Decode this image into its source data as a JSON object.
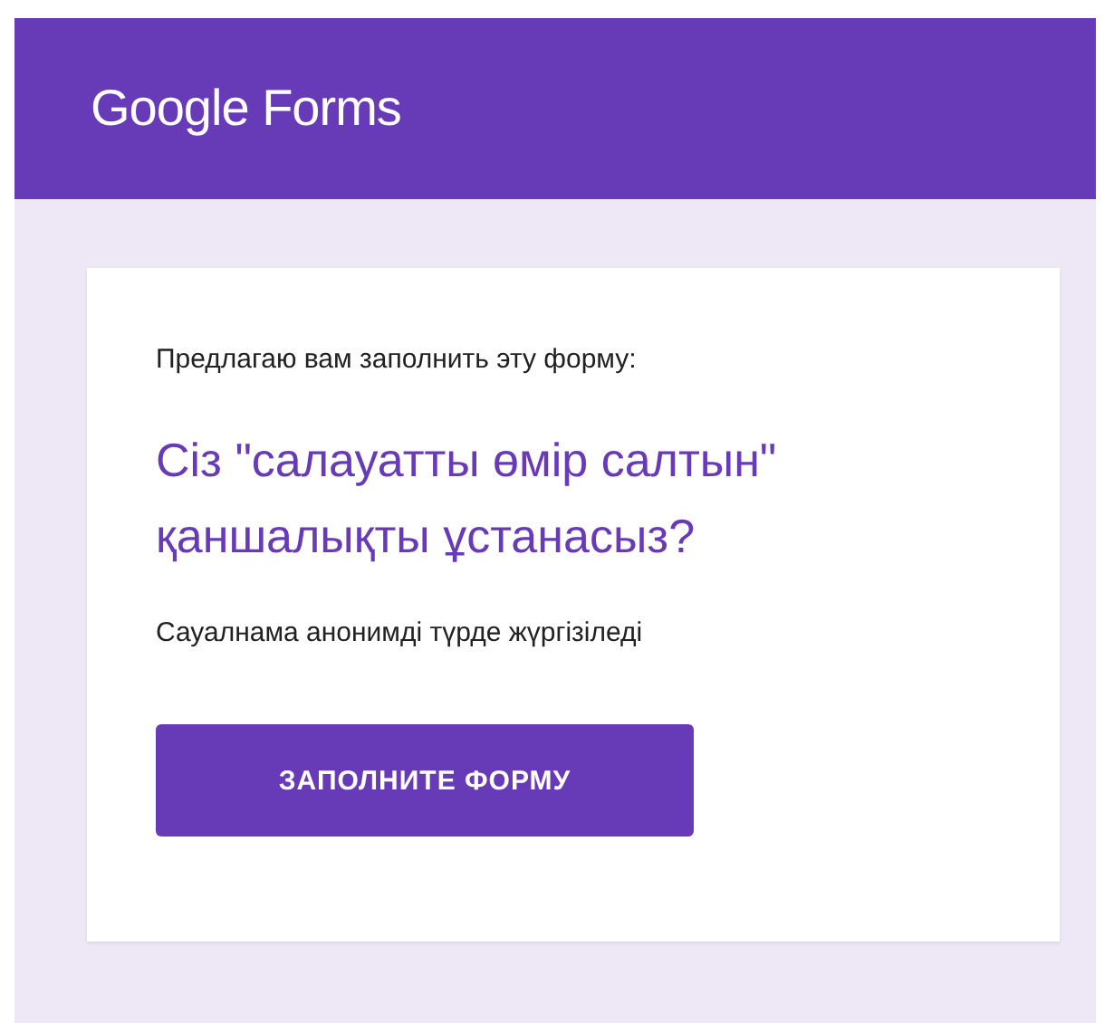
{
  "header": {
    "logo": "Google Forms"
  },
  "card": {
    "intro": "Предлагаю вам заполнить эту форму:",
    "title": "Сіз \"салауатты өмір салтын\" қаншалықты ұстанасыз?",
    "note": "Сауалнама анонимді түрде жүргізіледі",
    "button": "ЗАПОЛНИТЕ ФОРМУ"
  }
}
